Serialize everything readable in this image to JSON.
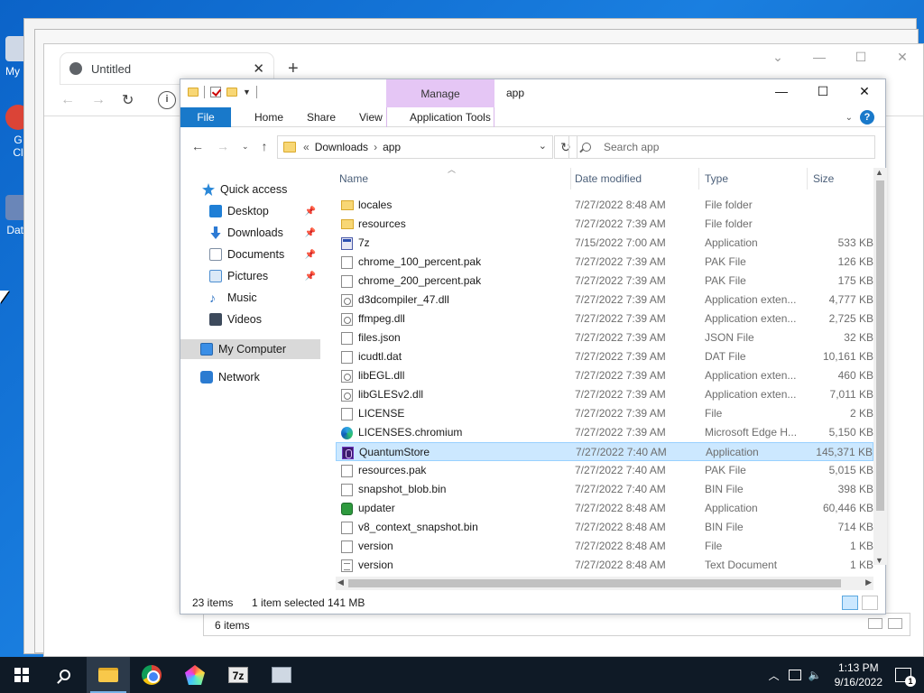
{
  "desktop": {
    "icons": [
      {
        "label": "My C"
      },
      {
        "label": "G\nCl"
      },
      {
        "label": "Data"
      }
    ]
  },
  "chrome": {
    "tab_title": "Untitled",
    "tab_close": "✕",
    "new_tab": "+",
    "controls": [
      "⌄",
      "—",
      "☐",
      "✕"
    ],
    "info": "i",
    "bottom_text": "6 items"
  },
  "explorer": {
    "title": "app",
    "manage_label": "Manage",
    "ribbon_tabs": [
      "File",
      "Home",
      "Share",
      "View",
      "Application Tools"
    ],
    "help": "?",
    "address": {
      "prefix": "«",
      "segments": [
        "Downloads",
        "app"
      ]
    },
    "search_placeholder": "Search app",
    "sidebar": [
      {
        "label": "Quick access",
        "icon": "star-icon",
        "color": "#2b88d8",
        "pinned": false
      },
      {
        "label": "Desktop",
        "icon": "desktop-icon",
        "color": "#1f7fd6",
        "pinned": true
      },
      {
        "label": "Downloads",
        "icon": "download-arrow-icon",
        "color": "#2c7ad4",
        "pinned": true
      },
      {
        "label": "Documents",
        "icon": "documents-icon",
        "color": "#7f8fa4",
        "pinned": true
      },
      {
        "label": "Pictures",
        "icon": "pictures-icon",
        "color": "#4e8fd1",
        "pinned": true
      },
      {
        "label": "Music",
        "icon": "music-note-icon",
        "color": "#2d73c4",
        "pinned": false
      },
      {
        "label": "Videos",
        "icon": "videos-icon",
        "color": "#3d4a5c",
        "pinned": false
      },
      {
        "label": "My Computer",
        "icon": "computer-icon",
        "color": "#3a8ee6",
        "pinned": false,
        "selected": true
      },
      {
        "label": "Network",
        "icon": "network-icon",
        "color": "#2b7bd1",
        "pinned": false
      }
    ],
    "columns": [
      "Name",
      "Date modified",
      "Type",
      "Size"
    ],
    "files": [
      {
        "name": "locales",
        "date": "7/27/2022 8:48 AM",
        "type": "File folder",
        "size": "",
        "icon": "folder"
      },
      {
        "name": "resources",
        "date": "7/27/2022 7:39 AM",
        "type": "File folder",
        "size": "",
        "icon": "folder"
      },
      {
        "name": "7z",
        "date": "7/15/2022 7:00 AM",
        "type": "Application",
        "size": "533 KB",
        "icon": "app"
      },
      {
        "name": "chrome_100_percent.pak",
        "date": "7/27/2022 7:39 AM",
        "type": "PAK File",
        "size": "126 KB",
        "icon": "page"
      },
      {
        "name": "chrome_200_percent.pak",
        "date": "7/27/2022 7:39 AM",
        "type": "PAK File",
        "size": "175 KB",
        "icon": "page"
      },
      {
        "name": "d3dcompiler_47.dll",
        "date": "7/27/2022 7:39 AM",
        "type": "Application exten...",
        "size": "4,777 KB",
        "icon": "gear"
      },
      {
        "name": "ffmpeg.dll",
        "date": "7/27/2022 7:39 AM",
        "type": "Application exten...",
        "size": "2,725 KB",
        "icon": "gear"
      },
      {
        "name": "files.json",
        "date": "7/27/2022 7:39 AM",
        "type": "JSON File",
        "size": "32 KB",
        "icon": "page"
      },
      {
        "name": "icudtl.dat",
        "date": "7/27/2022 7:39 AM",
        "type": "DAT File",
        "size": "10,161 KB",
        "icon": "page"
      },
      {
        "name": "libEGL.dll",
        "date": "7/27/2022 7:39 AM",
        "type": "Application exten...",
        "size": "460 KB",
        "icon": "gear"
      },
      {
        "name": "libGLESv2.dll",
        "date": "7/27/2022 7:39 AM",
        "type": "Application exten...",
        "size": "7,011 KB",
        "icon": "gear"
      },
      {
        "name": "LICENSE",
        "date": "7/27/2022 7:39 AM",
        "type": "File",
        "size": "2 KB",
        "icon": "page"
      },
      {
        "name": "LICENSES.chromium",
        "date": "7/27/2022 7:39 AM",
        "type": "Microsoft Edge H...",
        "size": "5,150 KB",
        "icon": "edge"
      },
      {
        "name": "QuantumStore",
        "date": "7/27/2022 7:40 AM",
        "type": "Application",
        "size": "145,371 KB",
        "icon": "quantum",
        "selected": true
      },
      {
        "name": "resources.pak",
        "date": "7/27/2022 7:40 AM",
        "type": "PAK File",
        "size": "5,015 KB",
        "icon": "page"
      },
      {
        "name": "snapshot_blob.bin",
        "date": "7/27/2022 7:40 AM",
        "type": "BIN File",
        "size": "398 KB",
        "icon": "page"
      },
      {
        "name": "updater",
        "date": "7/27/2022 8:48 AM",
        "type": "Application",
        "size": "60,446 KB",
        "icon": "updater"
      },
      {
        "name": "v8_context_snapshot.bin",
        "date": "7/27/2022 8:48 AM",
        "type": "BIN File",
        "size": "714 KB",
        "icon": "page"
      },
      {
        "name": "version",
        "date": "7/27/2022 8:48 AM",
        "type": "File",
        "size": "1 KB",
        "icon": "page"
      },
      {
        "name": "version",
        "date": "7/27/2022 8:48 AM",
        "type": "Text Document",
        "size": "1 KB",
        "icon": "text"
      }
    ],
    "status": {
      "items": "23 items",
      "selected": "1 item selected",
      "size": "141 MB"
    }
  },
  "taskbar": {
    "time": "1:13 PM",
    "date": "9/16/2022",
    "notification_count": "1",
    "seven_zip_label": "7z"
  }
}
